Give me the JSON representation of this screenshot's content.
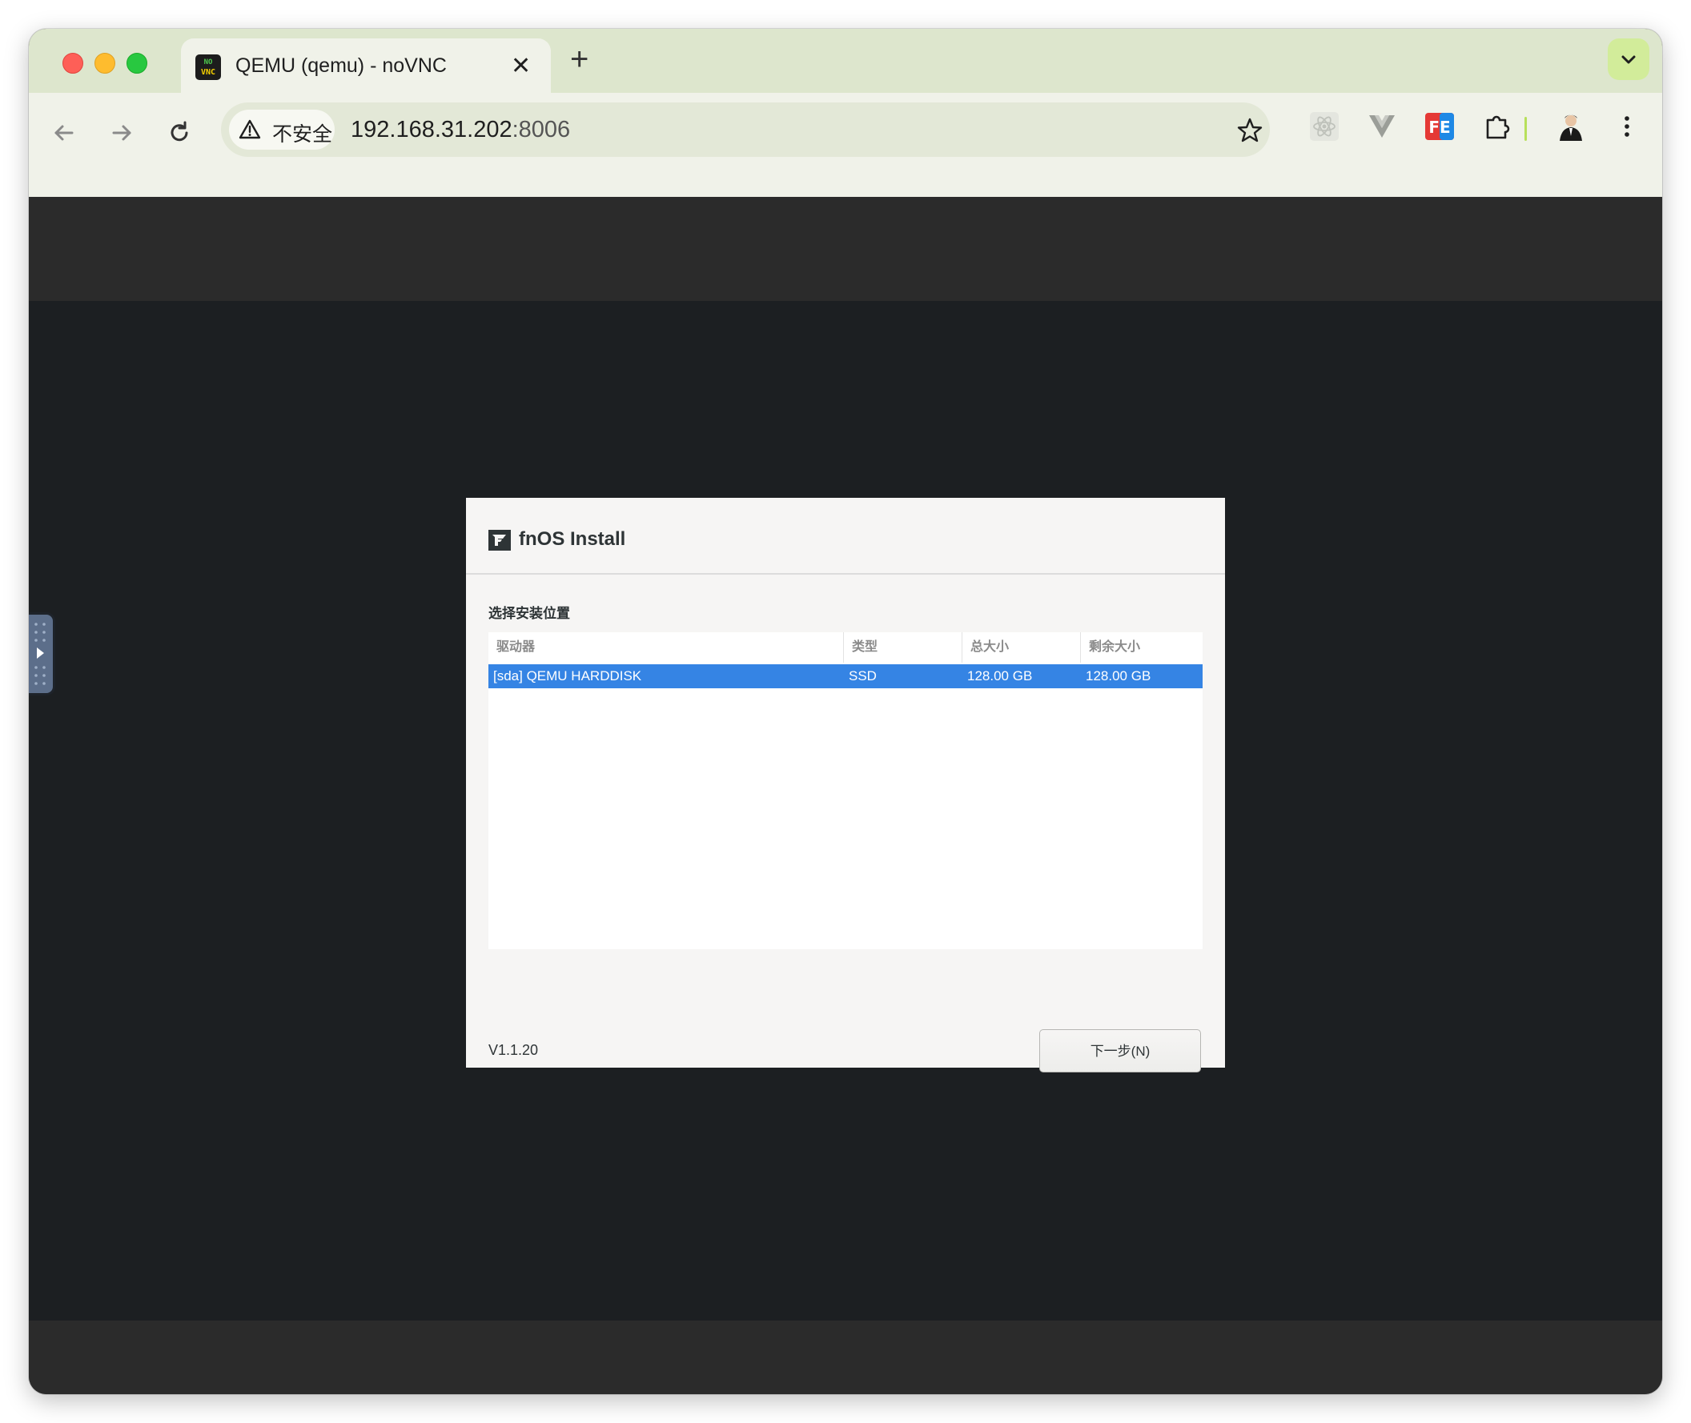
{
  "browser": {
    "tab": {
      "title": "QEMU (qemu) - noVNC",
      "favicon_top": "NO",
      "favicon_bottom": "VNC",
      "close_glyph": "✕"
    },
    "new_tab_glyph": "+",
    "omnibox": {
      "security_label": "不安全",
      "url_host": "192.168.31.202",
      "url_port": ":8006"
    },
    "icons": [
      "back-arrow-icon",
      "forward-arrow-icon",
      "reload-icon",
      "warning-icon",
      "bookmark-star-icon",
      "react-devtools-icon",
      "vue-devtools-icon",
      "fe-extension-icon",
      "extensions-puzzle-icon",
      "profile-avatar-icon",
      "more-menu-icon",
      "tab-search-chevron-icon"
    ]
  },
  "installer": {
    "title": "fnOS Install",
    "subtitle": "选择安装位置",
    "columns": [
      "驱动器",
      "类型",
      "总大小",
      "剩余大小"
    ],
    "rows": [
      {
        "drive": "[sda] QEMU HARDDISK",
        "type": "SSD",
        "total": "128.00 GB",
        "free": "128.00 GB",
        "selected": true
      }
    ],
    "version": "V1.1.20",
    "next_label": "下一步(N)"
  },
  "colors": {
    "tabstrip": "#dde6cd",
    "toolbar": "#f0f2e9",
    "selection": "#3584e4",
    "vnc_background": "#1c1f22"
  }
}
